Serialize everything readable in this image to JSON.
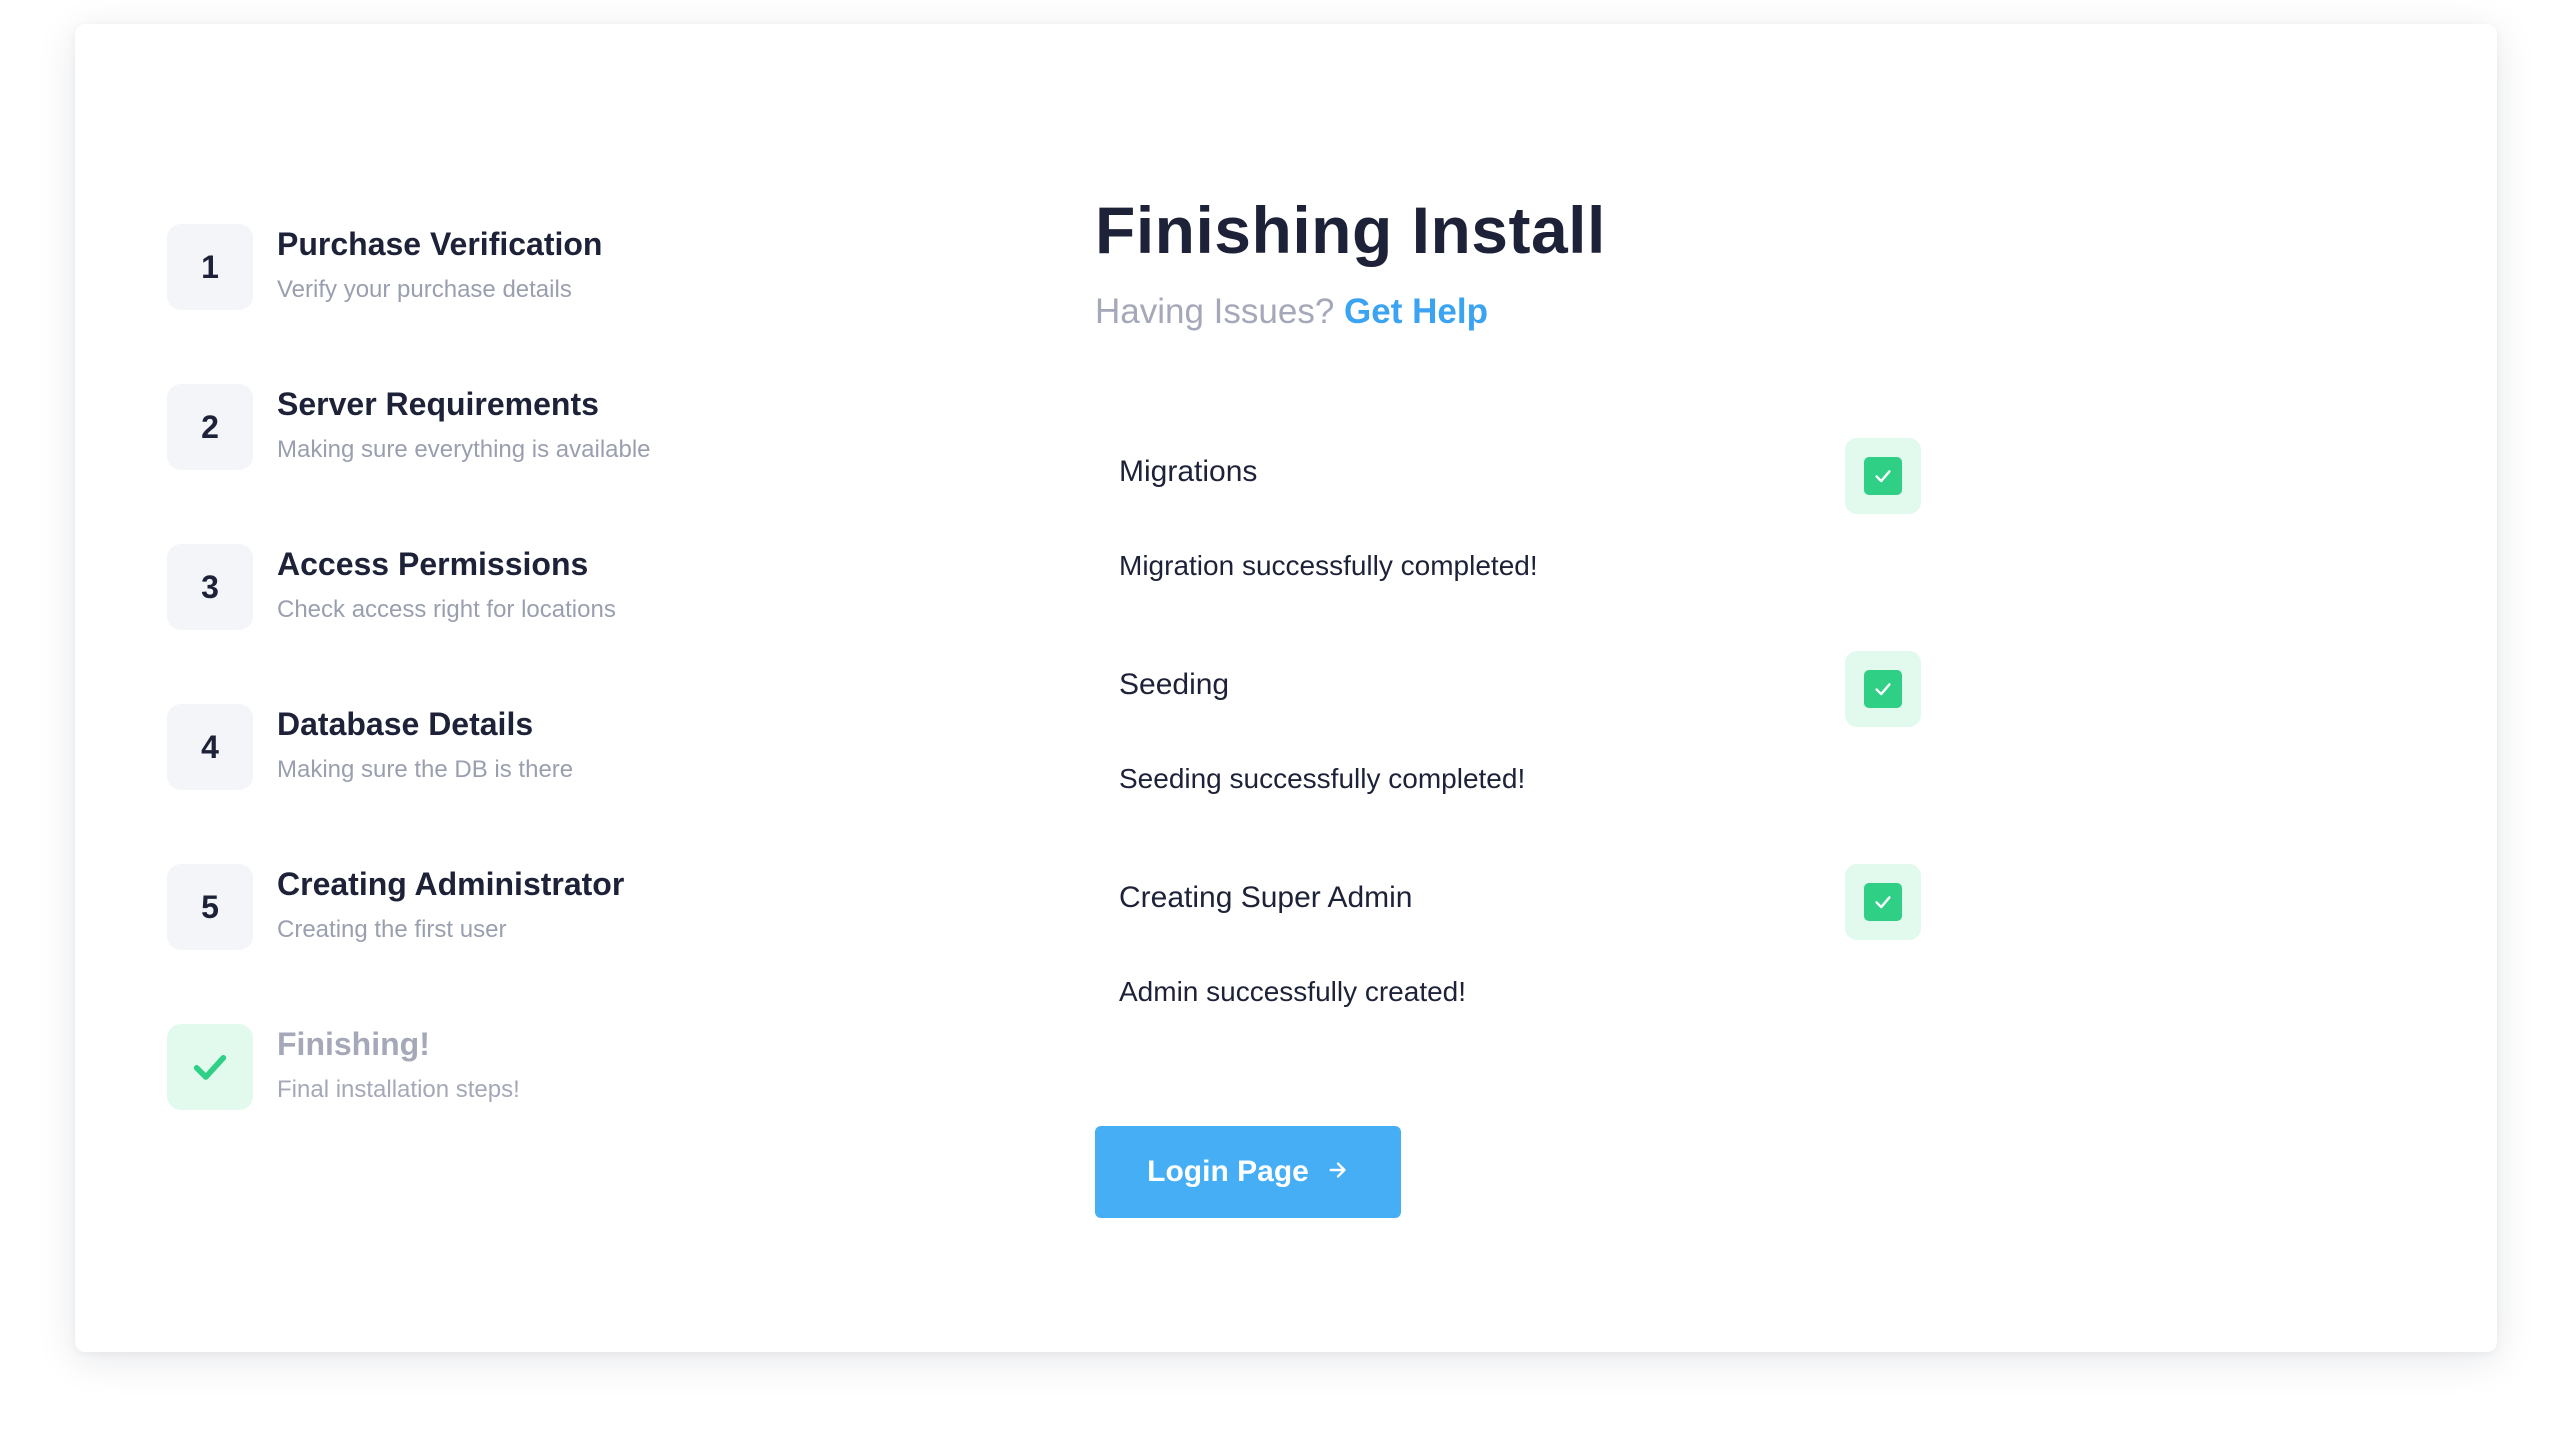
{
  "steps": [
    {
      "number": "1",
      "title": "Purchase Verification",
      "description": "Verify your purchase details"
    },
    {
      "number": "2",
      "title": "Server Requirements",
      "description": "Making sure everything is available"
    },
    {
      "number": "3",
      "title": "Access Permissions",
      "description": "Check access right for locations"
    },
    {
      "number": "4",
      "title": "Database Details",
      "description": "Making sure the DB is there"
    },
    {
      "number": "5",
      "title": "Creating Administrator",
      "description": "Creating the first user"
    },
    {
      "title": "Finishing!",
      "description": "Final installation steps!",
      "icon": "check-icon"
    }
  ],
  "main": {
    "title": "Finishing Install",
    "subtitle_prefix": "Having Issues?",
    "help_link": "Get Help"
  },
  "tasks": [
    {
      "name": "Migrations",
      "message": "Migration successfully completed!",
      "icon": "checkbox-checked-icon"
    },
    {
      "name": "Seeding",
      "message": "Seeding successfully completed!",
      "icon": "checkbox-checked-icon"
    },
    {
      "name": "Creating Super Admin",
      "message": "Admin successfully created!",
      "icon": "checkbox-checked-icon"
    }
  ],
  "login_button": {
    "label": "Login Page",
    "icon": "arrow-right-icon"
  },
  "colors": {
    "accent": "#45aef5",
    "link": "#3aa3f2",
    "success": "#2fcf86",
    "success_bg": "#e2f9ee",
    "text_dark": "#1d2238",
    "text_muted": "#9a9fb0"
  }
}
